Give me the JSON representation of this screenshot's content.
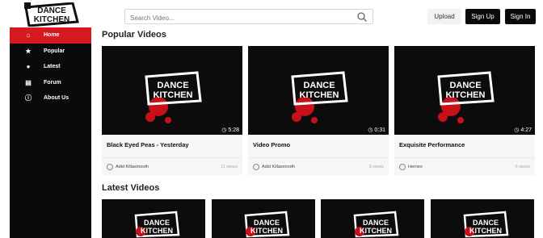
{
  "header": {
    "logo_text_line1": "DANCE",
    "logo_text_line2": "KITCHEN",
    "search_placeholder": "Search Video...",
    "upload_label": "Upload",
    "signup_label": "Sign Up",
    "signin_label": "Sign In"
  },
  "sidebar": {
    "items": [
      {
        "label": "Home",
        "icon": "home-icon",
        "active": true
      },
      {
        "label": "Popular",
        "icon": "star-icon",
        "active": false
      },
      {
        "label": "Latest",
        "icon": "globe-icon",
        "active": false
      },
      {
        "label": "Forum",
        "icon": "forum-icon",
        "active": false
      },
      {
        "label": "About Us",
        "icon": "info-icon",
        "active": false
      }
    ]
  },
  "popular": {
    "title": "Popular Videos",
    "videos": [
      {
        "title": "Black Eyed Peas - Yesterday",
        "duration": "5:28",
        "author": "Adid Killasmooth",
        "views": "11 views"
      },
      {
        "title": "Video Promo",
        "duration": "0:31",
        "author": "Adid Killasmooth",
        "views": "9 views"
      },
      {
        "title": "Exquisite Performance",
        "duration": "4:27",
        "author": "Heroes",
        "views": "6 views"
      }
    ]
  },
  "latest": {
    "title": "Latest Videos"
  },
  "colors": {
    "accent": "#d71920",
    "dark": "#0a0a0a"
  }
}
